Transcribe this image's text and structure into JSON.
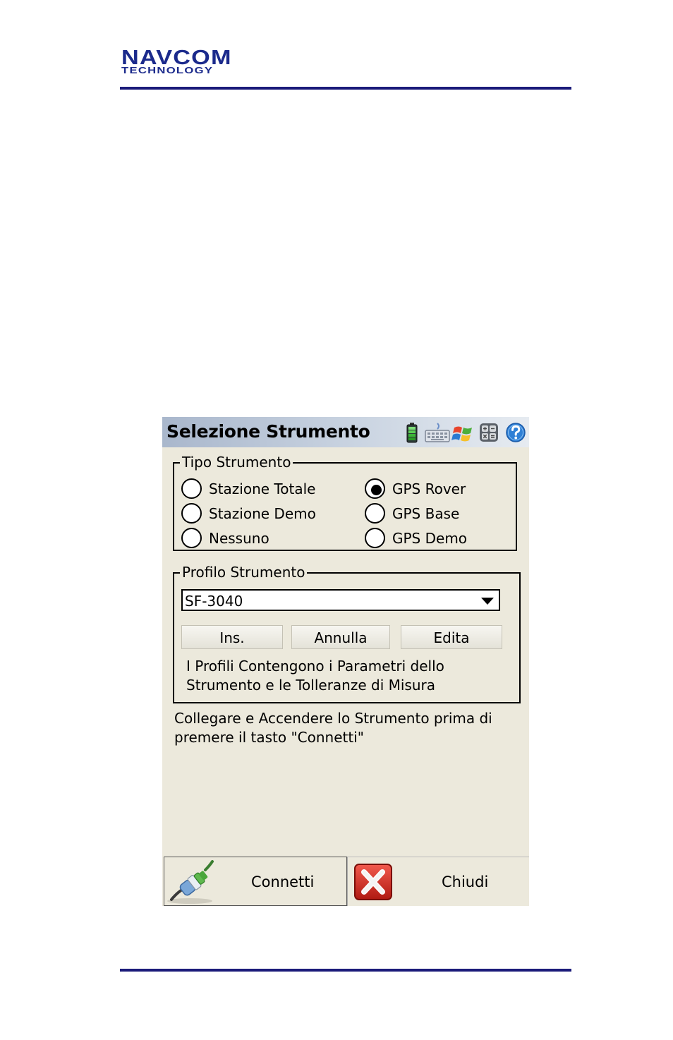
{
  "document": {
    "logo_line1": "NAVCOM",
    "logo_line2": "TECHNOLOGY",
    "accent_color": "#1b1b7a"
  },
  "window": {
    "title": "Selezione Strumento",
    "tray_icons": [
      "battery-icon",
      "keyboard-icon",
      "windows-start-icon",
      "settings-icon",
      "help-icon"
    ]
  },
  "instrument_type": {
    "legend": "Tipo Strumento",
    "options": [
      {
        "label": "Stazione Totale",
        "selected": false
      },
      {
        "label": "Stazione Demo",
        "selected": false
      },
      {
        "label": "Nessuno",
        "selected": false
      },
      {
        "label": "GPS Rover",
        "selected": true
      },
      {
        "label": "GPS Base",
        "selected": false
      },
      {
        "label": "GPS Demo",
        "selected": false
      }
    ]
  },
  "profile": {
    "legend": "Profilo Strumento",
    "selected": "SF-3040",
    "buttons": {
      "insert": "Ins.",
      "cancel": "Annulla",
      "edit": "Edita"
    },
    "note_line1": "I Profili Contengono i Parametri dello",
    "note_line2": "Strumento e le Tolleranze di Misura"
  },
  "instructions": {
    "line1": "Collegare e Accendere lo Strumento prima di",
    "line2": "premere il tasto \"Connetti\""
  },
  "footer": {
    "connect_label": "Connetti",
    "close_label": "Chiudi"
  }
}
